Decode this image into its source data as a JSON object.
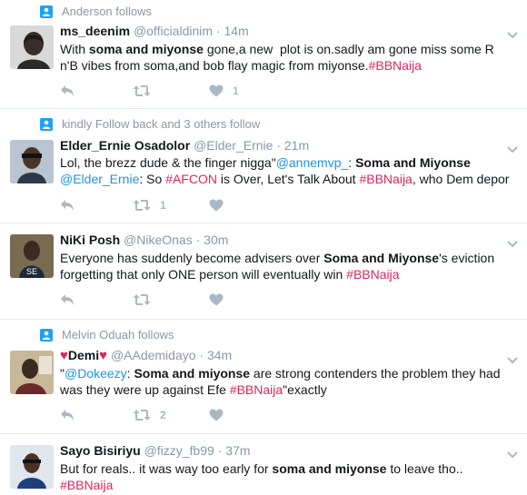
{
  "tweets": [
    {
      "context": "Anderson follows",
      "name": "ms_deenim",
      "handle": "@officialdinim",
      "time": "14m",
      "lines": [
        [
          {
            "t": "With "
          },
          {
            "t": "soma and miyonse",
            "b": true
          },
          {
            "t": " gone,a new  plot is on.sadly am gone miss some R"
          }
        ],
        [
          {
            "t": "n'B vibes from soma,and bob flay magic from miyonse."
          },
          {
            "t": "#BBNaija",
            "c": "ht"
          }
        ]
      ],
      "retweets": "",
      "likes": "1"
    },
    {
      "context": "kindly Follow back and 3 others follow",
      "name": "Elder_Ernie Osadolor",
      "handle": "@Elder_Ernie",
      "time": "21m",
      "lines": [
        [
          {
            "t": "Lol, the brezz dude & the finger nigga\""
          },
          {
            "t": "@annemvp_",
            "c": "mention"
          },
          {
            "t": ": "
          },
          {
            "t": "Soma and Miyonse",
            "b": true
          }
        ],
        [
          {
            "t": "@Elder_Ernie",
            "c": "mention"
          },
          {
            "t": ": So "
          },
          {
            "t": "#AFCON",
            "c": "ht"
          },
          {
            "t": " is Over, Let's Talk About "
          },
          {
            "t": "#BBNaija",
            "c": "ht"
          },
          {
            "t": ", who Dem depor"
          }
        ]
      ],
      "retweets": "1",
      "likes": ""
    },
    {
      "context": "",
      "name": "NiKi Posh",
      "handle": "@NikeOnas",
      "time": "30m",
      "lines": [
        [
          {
            "t": "Everyone has suddenly become advisers over "
          },
          {
            "t": "Soma and Miyonse",
            "b": true
          },
          {
            "t": "'s eviction"
          }
        ],
        [
          {
            "t": "forgetting that only ONE person will eventually win "
          },
          {
            "t": "#BBNaija",
            "c": "ht"
          }
        ]
      ],
      "retweets": "",
      "likes": ""
    },
    {
      "context": "Melvin Oduah follows",
      "name": "Demi",
      "name_prefix": "♥",
      "name_suffix": "♥",
      "handle": "@AAdemidayo",
      "time": "34m",
      "lines": [
        [
          {
            "t": "\""
          },
          {
            "t": "@Dokeezy",
            "c": "mention"
          },
          {
            "t": ": "
          },
          {
            "t": "Soma and miyonse",
            "b": true
          },
          {
            "t": " are strong contenders the problem they had"
          }
        ],
        [
          {
            "t": "was they were up against Efe "
          },
          {
            "t": "#BBNaija",
            "c": "ht"
          },
          {
            "t": "\"exactly"
          }
        ]
      ],
      "retweets": "2",
      "likes": ""
    },
    {
      "context": "",
      "name": "Sayo Bisiriyu",
      "handle": "@fizzy_fb99",
      "time": "37m",
      "lines": [
        [
          {
            "t": "But for reals.. it was way too early for "
          },
          {
            "t": "soma and miyonse",
            "b": true
          },
          {
            "t": " to leave tho.."
          }
        ],
        [
          {
            "t": "#BBNaija",
            "c": "ht"
          }
        ]
      ],
      "retweets": "",
      "likes": ""
    }
  ],
  "dot": "·",
  "colors": {
    "hashtag": "#e0245e",
    "mention": "#1b95e0",
    "muted": "#8899a6",
    "action": "#aab8c2",
    "context_icon": "#1da1f2"
  },
  "icons": {
    "context": "person-follow-icon",
    "reply": "reply-icon",
    "retweet": "retweet-icon",
    "like": "heart-icon",
    "menu": "chevron-down-icon"
  }
}
